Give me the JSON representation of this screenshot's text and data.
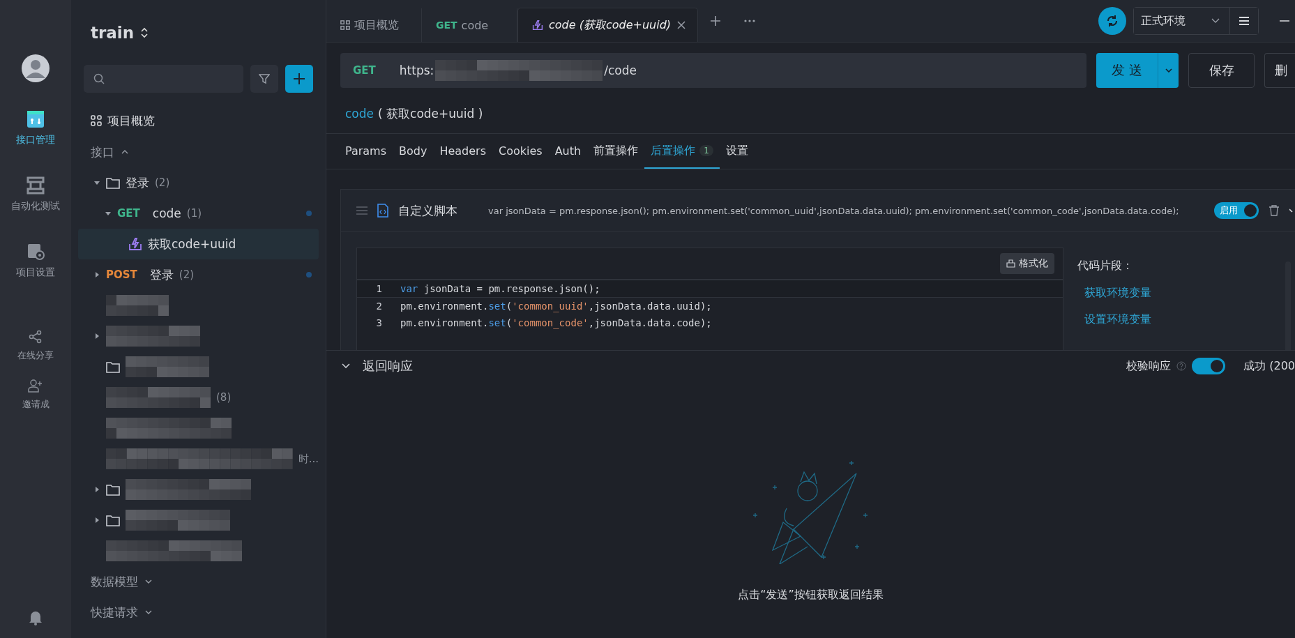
{
  "rail": {
    "items": [
      {
        "kind": "api",
        "label": "接口管理",
        "selected": true
      },
      {
        "kind": "auto",
        "label": "自动化测试",
        "selected": false
      },
      {
        "kind": "settings",
        "label": "项目设置",
        "selected": false
      },
      {
        "kind": "share",
        "label": "在线分享",
        "selected": false
      },
      {
        "kind": "invite",
        "label": "邀请成",
        "selected": false
      }
    ]
  },
  "sidebar": {
    "project": "train",
    "overview": "项目概览",
    "sections": [
      {
        "label": "接口",
        "expanded": true
      },
      {
        "label": "数据模型",
        "expanded": false
      },
      {
        "label": "快捷请求",
        "expanded": false
      }
    ],
    "tree": [
      {
        "kind": "folder",
        "label": "登录",
        "count": "(2)",
        "expanded": true,
        "children": [
          {
            "kind": "api",
            "method": "GET",
            "label": "code",
            "count": "(1)",
            "expanded": true,
            "children": [
              {
                "kind": "case",
                "label": "获取code+uuid",
                "selected": true
              }
            ]
          }
        ]
      },
      {
        "kind": "api",
        "method": "POST",
        "label": "登录",
        "count": "(2)",
        "expanded": false
      }
    ],
    "hidden_rows": [
      {
        "caret": false,
        "folder": false
      },
      {
        "caret": true,
        "folder": false
      },
      {
        "caret": false,
        "folder": true
      },
      {
        "caret": false,
        "folder": false,
        "suffix": "(8)"
      },
      {
        "caret": false,
        "folder": false
      },
      {
        "caret": false,
        "folder": false,
        "suffix": "时..."
      },
      {
        "caret": true,
        "folder": true
      },
      {
        "caret": true,
        "folder": true
      },
      {
        "caret": false,
        "folder": false
      }
    ]
  },
  "tabs": [
    {
      "kind": "overview",
      "label": "项目概览",
      "selected": false
    },
    {
      "kind": "api",
      "method": "GET",
      "label": "code",
      "selected": false
    },
    {
      "kind": "case",
      "label": "code (获取code+uuid)",
      "selected": true
    }
  ],
  "environment": "正式环境",
  "request": {
    "method": "GET",
    "url_start": "https:",
    "url_end": "/code",
    "send": "发 送",
    "save": "保存",
    "delete": "删"
  },
  "title": {
    "name": "code",
    "case": "( 获取code+uuid )"
  },
  "subtabs": [
    {
      "label": "Params",
      "selected": false
    },
    {
      "label": "Body",
      "selected": false
    },
    {
      "label": "Headers",
      "selected": false
    },
    {
      "label": "Cookies",
      "selected": false
    },
    {
      "label": "Auth",
      "selected": false
    },
    {
      "label": "前置操作",
      "selected": false
    },
    {
      "label": "后置操作",
      "badge": "1",
      "selected": true
    },
    {
      "label": "设置",
      "selected": false
    }
  ],
  "script": {
    "title": "自定义脚本",
    "summary": "var jsonData = pm.response.json(); pm.environment.set('common_uuid',jsonData.data.uuid); pm.environment.set('common_code',jsonData.data.code);",
    "enabled_label": "启用",
    "enabled": true,
    "format": "格式化",
    "lines": [
      {
        "number": "1",
        "tokens": [
          {
            "kind": "keyword",
            "text": "var"
          },
          {
            "kind": "plain",
            "text": " jsonData = pm.response.json();"
          }
        ]
      },
      {
        "number": "2",
        "tokens": [
          {
            "kind": "plain",
            "text": "pm.environment."
          },
          {
            "kind": "keyword",
            "text": "set"
          },
          {
            "kind": "plain",
            "text": "("
          },
          {
            "kind": "string",
            "text": "'common_uuid'"
          },
          {
            "kind": "plain",
            "text": ",jsonData.data.uuid);"
          }
        ]
      },
      {
        "number": "3",
        "tokens": [
          {
            "kind": "plain",
            "text": "pm.environment."
          },
          {
            "kind": "keyword",
            "text": "set"
          },
          {
            "kind": "plain",
            "text": "("
          },
          {
            "kind": "string",
            "text": "'common_code'"
          },
          {
            "kind": "plain",
            "text": ",jsonData.data.code);"
          }
        ]
      }
    ],
    "snippets_title": "代码片段：",
    "snippets": [
      "获取环境变量",
      "设置环境变量"
    ]
  },
  "response": {
    "title": "返回响应",
    "expanded": true,
    "validate_label": "校验响应",
    "validate": true,
    "status": "成功 (200",
    "empty_text": "点击“发送”按钮获取返回结果"
  }
}
